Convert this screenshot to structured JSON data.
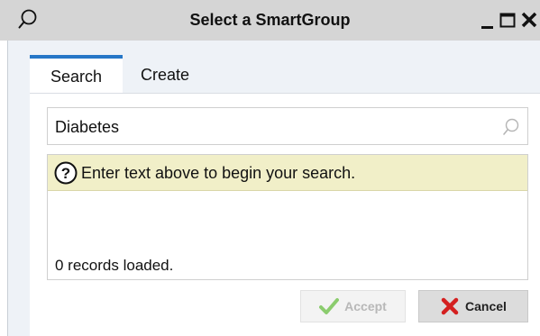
{
  "window": {
    "title": "Select a SmartGroup",
    "icons": [
      "search-icon",
      "minimize-icon",
      "maximize-icon",
      "close-icon"
    ]
  },
  "tabs": [
    {
      "label": "Search",
      "active": true
    },
    {
      "label": "Create",
      "active": false
    }
  ],
  "search": {
    "value": "Diabetes",
    "icon": "search-icon"
  },
  "hint": {
    "text": "Enter text above to begin your search.",
    "icon": "help-icon"
  },
  "status": {
    "records_text": "0 records loaded."
  },
  "buttons": {
    "accept_label": "Accept",
    "accept_enabled": false,
    "cancel_label": "Cancel"
  },
  "colors": {
    "title_bar": "#d5d5d5",
    "active_tab_accent": "#2677c7",
    "hint_background": "#f1efc8",
    "accept_icon": "#8bcc6e",
    "cancel_icon": "#d42020"
  }
}
